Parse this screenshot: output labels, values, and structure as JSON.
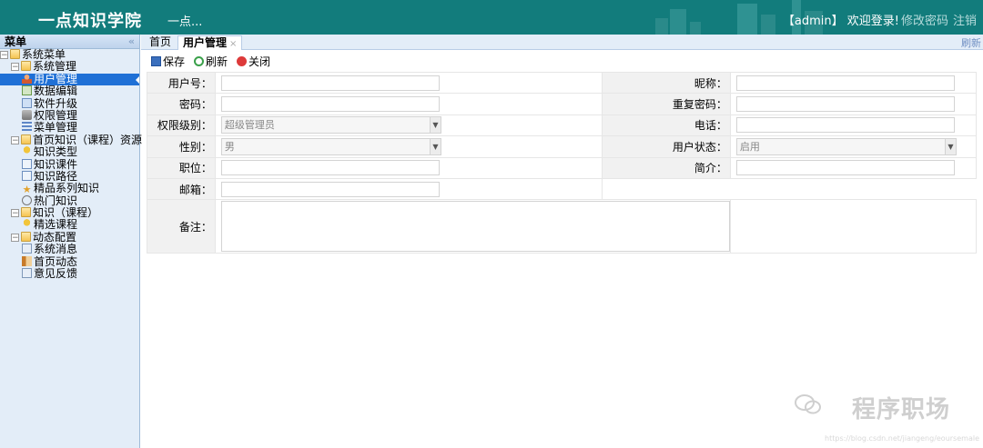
{
  "header": {
    "brand": "一点知识学院",
    "subtitle": "一点...",
    "welcome": "【admin】 欢迎登录!",
    "change_password": "修改密码",
    "logout": "注销"
  },
  "sidebar": {
    "title": "菜单",
    "tree": [
      {
        "label": "系统菜单",
        "level": 0,
        "icon": "folder-icon"
      },
      {
        "label": "系统管理",
        "level": 1,
        "icon": "folder-icon"
      },
      {
        "label": "用户管理",
        "level": 2,
        "icon": "user-icon",
        "active": true
      },
      {
        "label": "数据编辑",
        "level": 2,
        "icon": "grid-icon"
      },
      {
        "label": "软件升级",
        "level": 2,
        "icon": "software-icon"
      },
      {
        "label": "权限管理",
        "level": 2,
        "icon": "lock-icon"
      },
      {
        "label": "菜单管理",
        "level": 2,
        "icon": "list-icon"
      },
      {
        "label": "首页知识（课程）资源",
        "level": 1,
        "icon": "folder-icon"
      },
      {
        "label": "知识类型",
        "level": 2,
        "icon": "trophy-icon"
      },
      {
        "label": "知识课件",
        "level": 2,
        "icon": "card-icon"
      },
      {
        "label": "知识路径",
        "level": 2,
        "icon": "card-icon"
      },
      {
        "label": "精品系列知识",
        "level": 2,
        "icon": "star-icon"
      },
      {
        "label": "热门知识",
        "level": 2,
        "icon": "search-icon"
      },
      {
        "label": "知识（课程）",
        "level": 1,
        "icon": "folder-icon"
      },
      {
        "label": "精选课程",
        "level": 2,
        "icon": "trophy-icon"
      },
      {
        "label": "动态配置",
        "level": 1,
        "icon": "folder-icon"
      },
      {
        "label": "系统消息",
        "level": 2,
        "icon": "message-icon"
      },
      {
        "label": "首页动态",
        "level": 2,
        "icon": "book-icon"
      },
      {
        "label": "意见反馈",
        "level": 2,
        "icon": "message-icon"
      }
    ]
  },
  "tabs": {
    "home": "首页",
    "user": "用户管理",
    "close": "×",
    "refresh": "刷新"
  },
  "toolbar": {
    "save": "保存",
    "refresh": "刷新",
    "close": "关闭"
  },
  "form": {
    "user_id_label": "用户号：",
    "nickname_label": "昵称：",
    "password_label": "密码：",
    "repeat_password_label": "重复密码：",
    "permission_label": "权限级别：",
    "permission_value": "超级管理员",
    "phone_label": "电话：",
    "gender_label": "性别：",
    "gender_value": "男",
    "status_label": "用户状态：",
    "status_value": "启用",
    "position_label": "职位：",
    "intro_label": "简介：",
    "email_label": "邮箱：",
    "remark_label": "备注："
  },
  "watermark": {
    "text": "程序职场",
    "url": "https://blog.csdn.net/jiangeng/eoursemale"
  }
}
